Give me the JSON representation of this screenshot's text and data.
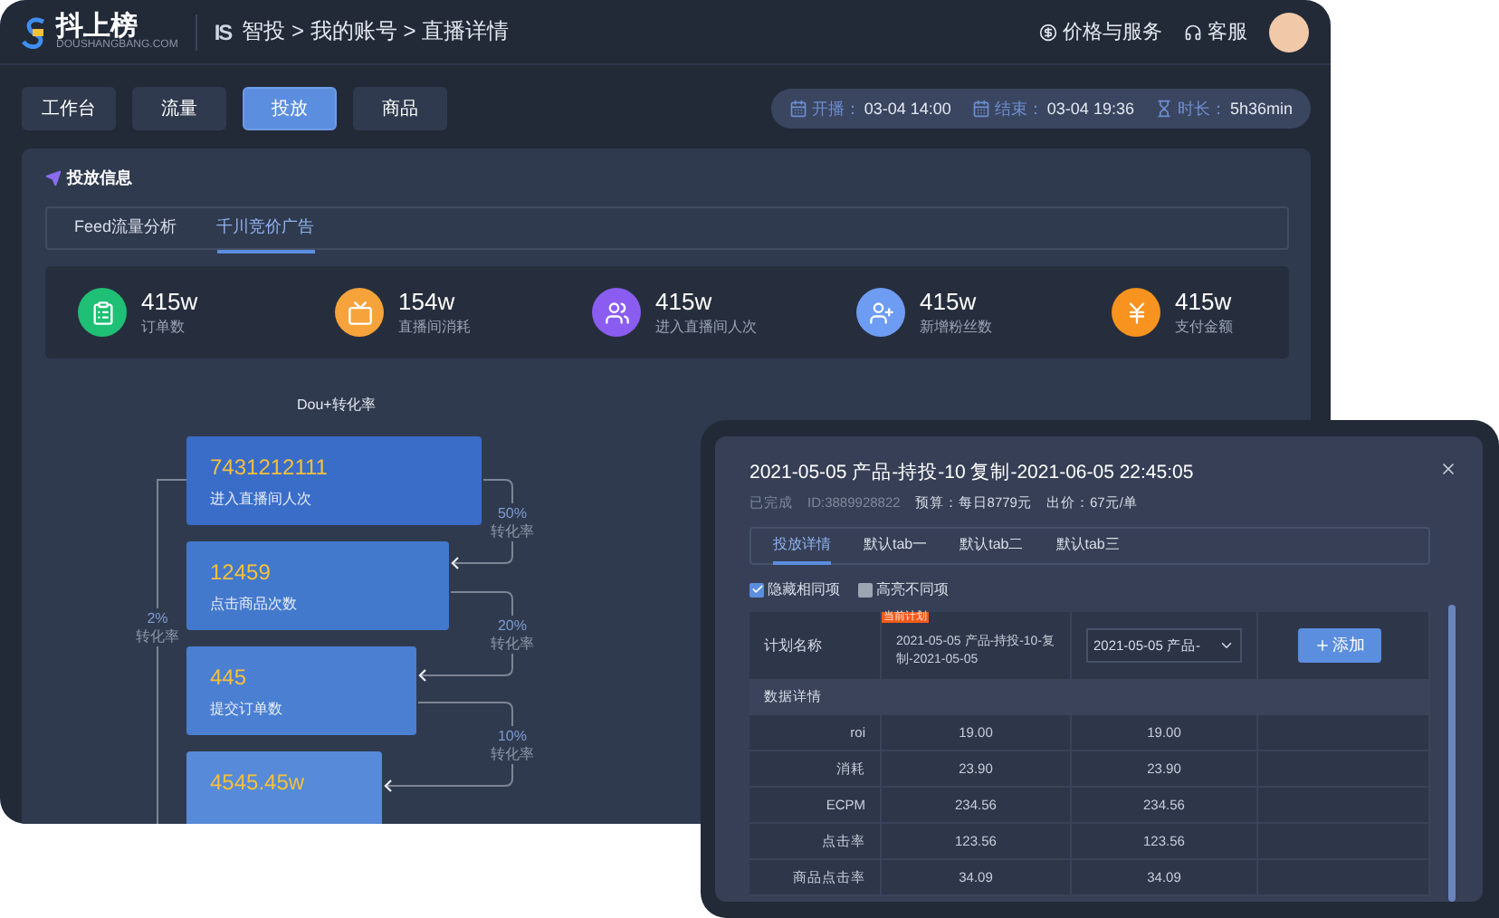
{
  "header": {
    "logo": {
      "name": "抖上榜",
      "domain": "DOUSHANGBANG.COM"
    },
    "app_mark": "IS",
    "breadcrumb": [
      "智投",
      "我的账号",
      "直播详情"
    ],
    "separator": ">",
    "links": [
      {
        "label": "价格与服务",
        "kind": "price"
      },
      {
        "label": "客服",
        "kind": "support"
      }
    ]
  },
  "nav_tabs": [
    {
      "label": "工作台",
      "selected": false
    },
    {
      "label": "流量",
      "selected": false
    },
    {
      "label": "投放",
      "selected": true
    },
    {
      "label": "商品",
      "selected": false
    }
  ],
  "time_info": [
    {
      "label": "开播：",
      "value": "03-04 14:00",
      "kind": "calendar"
    },
    {
      "label": "结束：",
      "value": "03-04 19:36",
      "kind": "calendar"
    },
    {
      "label": "时长：",
      "value": "5h36min",
      "kind": "hourglass"
    }
  ],
  "section_title": "投放信息",
  "sub_tabs": [
    {
      "label": "Feed流量分析",
      "selected": false
    },
    {
      "label": "千川竞价广告",
      "selected": true
    }
  ],
  "stats": [
    {
      "value": "415w",
      "label": "订单数",
      "kind": "orders",
      "color": "#1fbf75"
    },
    {
      "value": "154w",
      "label": "直播间消耗",
      "kind": "live",
      "color": "#f7a33b"
    },
    {
      "value": "415w",
      "label": "进入直播间人次",
      "kind": "visitors",
      "color": "#8a5cf0"
    },
    {
      "value": "415w",
      "label": "新增粉丝数",
      "kind": "fans",
      "color": "#6d9cf2"
    },
    {
      "value": "415w",
      "label": "支付金额",
      "kind": "money",
      "color": "#f7931e"
    }
  ],
  "funnel": {
    "title": "Dou+转化率",
    "steps": [
      {
        "value": "7431212111",
        "label": "进入直播间人次"
      },
      {
        "value": "12459",
        "label": "点击商品次数"
      },
      {
        "value": "445",
        "label": "提交订单数"
      },
      {
        "value": "4545.45w"
      }
    ],
    "conversions": [
      {
        "rate": "50%",
        "label": "转化率"
      },
      {
        "rate": "20%",
        "label": "转化率"
      },
      {
        "rate": "10%",
        "label": "转化率"
      }
    ],
    "overall": {
      "rate": "2%",
      "label": "转化率"
    }
  },
  "dialog": {
    "title": "2021-05-05 产品-持投-10 复制-2021-06-05 22:45:05",
    "status": "已完成",
    "id": "ID:3889928822",
    "budget": "预算：每日8779元",
    "bid": "出价：67元/单",
    "tabs": [
      {
        "label": "投放详情",
        "selected": true
      },
      {
        "label": "默认tab一",
        "selected": false
      },
      {
        "label": "默认tab二",
        "selected": false
      },
      {
        "label": "默认tab三",
        "selected": false
      }
    ],
    "options": [
      {
        "label": "隐藏相同项",
        "checked": true
      },
      {
        "label": "高亮不同项",
        "checked": false
      }
    ],
    "plan_row": {
      "label": "计划名称",
      "badge": "当前计划",
      "current": "2021-05-05 产品-持投-10-复制-2021-05-05",
      "select_value": "2021-05-05 产品-",
      "add_label": "添加"
    },
    "section": "数据详情",
    "rows": [
      {
        "metric": "roi",
        "values": [
          "19.00",
          "19.00"
        ]
      },
      {
        "metric": "消耗",
        "values": [
          "23.90",
          "23.90"
        ]
      },
      {
        "metric": "ECPM",
        "values": [
          "234.56",
          "234.56"
        ]
      },
      {
        "metric": "点击率",
        "values": [
          "123.56",
          "123.56"
        ]
      },
      {
        "metric": "商品点击率",
        "values": [
          "34.09",
          "34.09"
        ]
      }
    ]
  }
}
